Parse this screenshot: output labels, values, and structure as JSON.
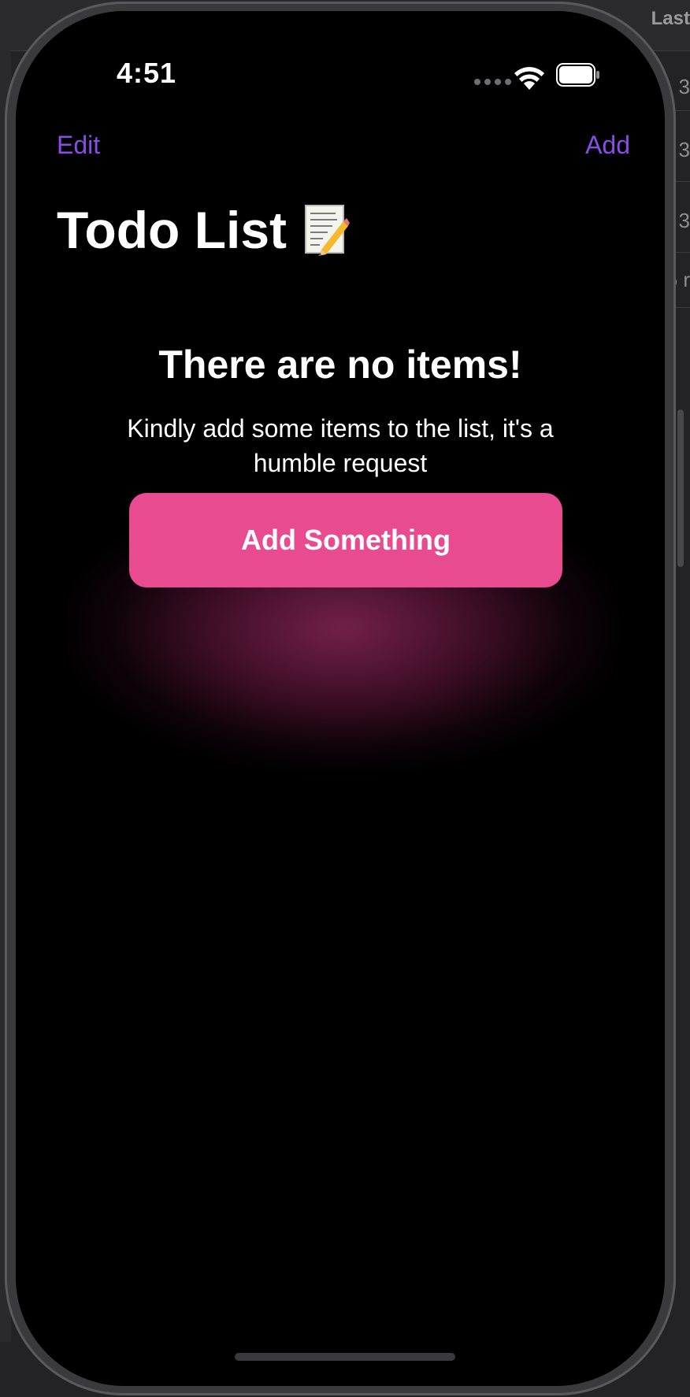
{
  "background_window": {
    "header_text": "Last",
    "row_values": [
      "3",
      "3",
      "3",
      "5 r"
    ]
  },
  "status_bar": {
    "time": "4:51"
  },
  "nav": {
    "edit_label": "Edit",
    "add_label": "Add"
  },
  "title": {
    "text": "Todo List",
    "emoji": "📝"
  },
  "empty_state": {
    "title": "There are no items!",
    "message": "Kindly add some items to the list, it's a humble request",
    "button_label": "Add Something"
  },
  "colors": {
    "accent": "#8a4ce6",
    "button": "#e94b91",
    "background": "#000000"
  }
}
